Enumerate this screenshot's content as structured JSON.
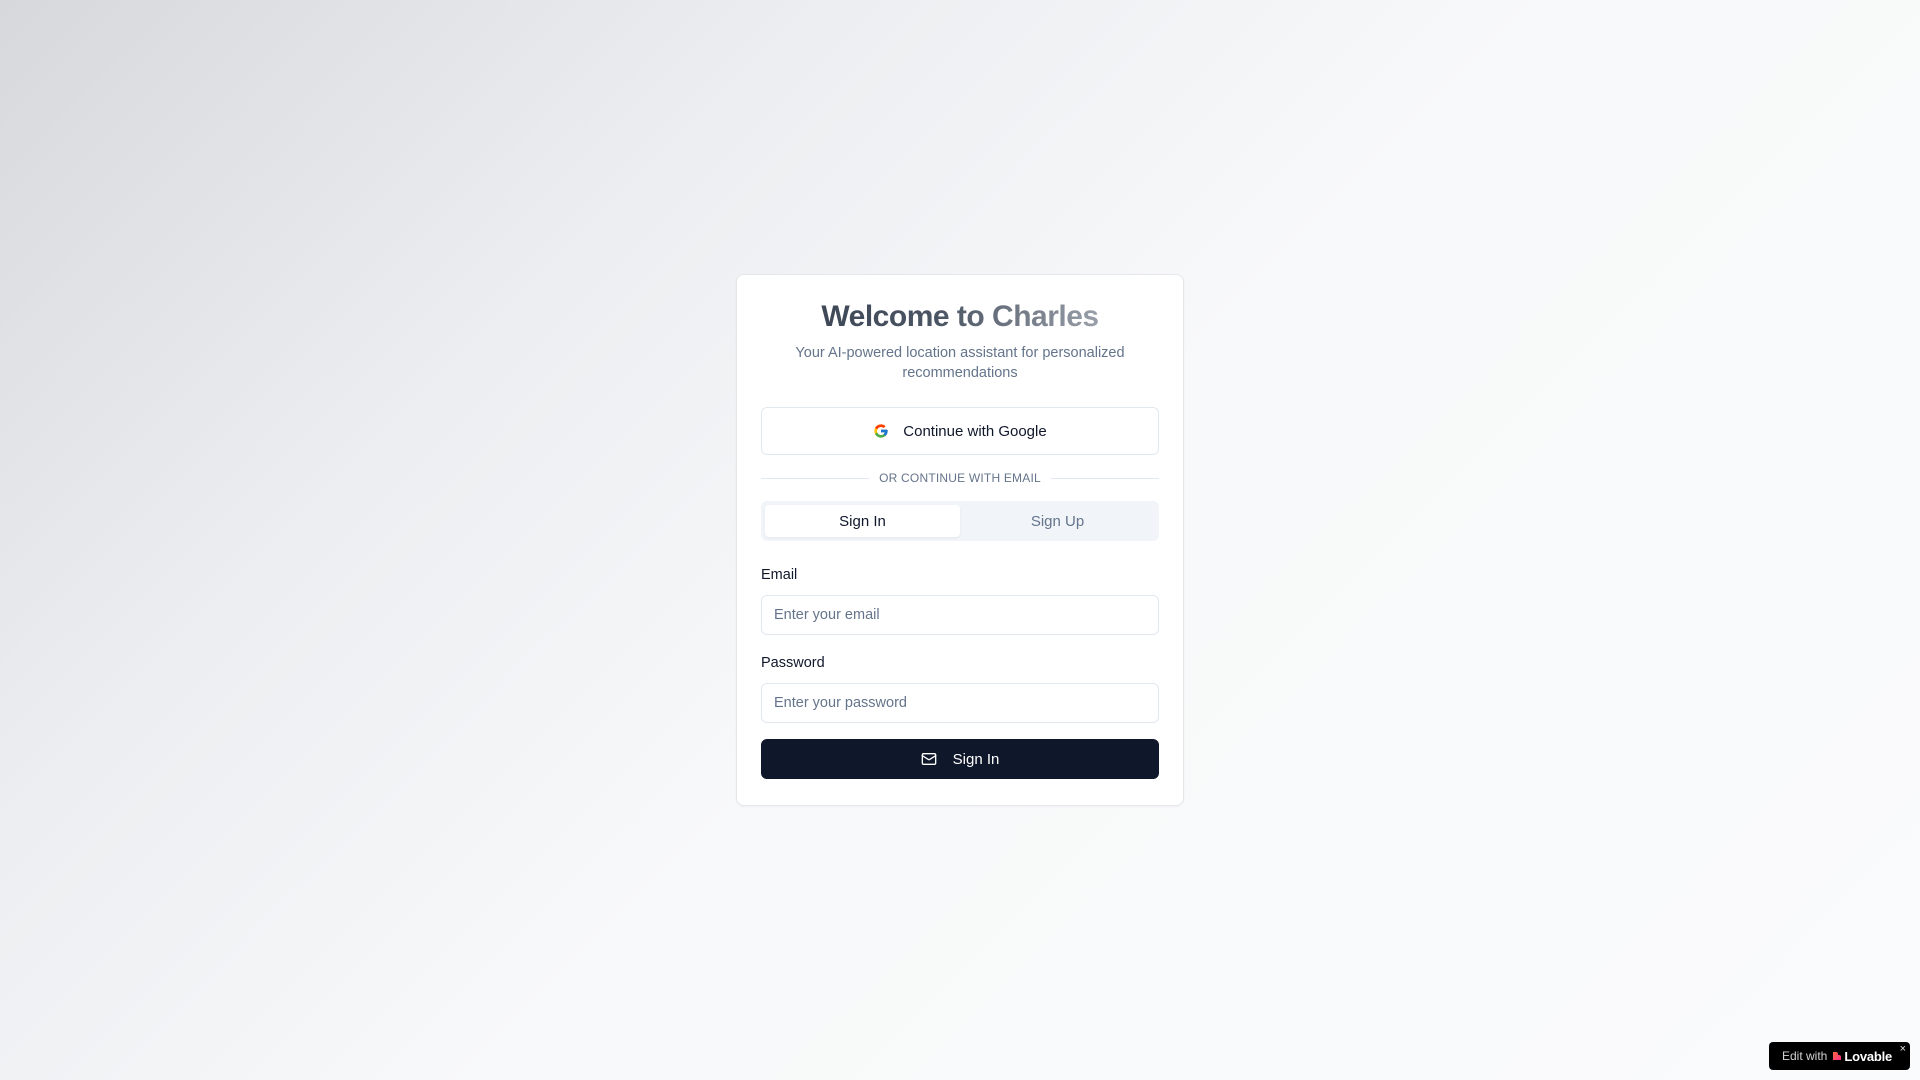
{
  "auth_card": {
    "title": "Welcome to Charles",
    "subtitle": "Your AI-powered location assistant for personalized recommendations",
    "google_button_label": "Continue with Google",
    "divider_text": "OR CONTINUE WITH EMAIL",
    "tabs": [
      {
        "label": "Sign In",
        "active": true
      },
      {
        "label": "Sign Up",
        "active": false
      }
    ],
    "email": {
      "label": "Email",
      "placeholder": "Enter your email",
      "value": ""
    },
    "password": {
      "label": "Password",
      "placeholder": "Enter your password",
      "value": ""
    },
    "submit_label": "Sign In",
    "submit_icon": "mail-icon",
    "google_icon": "google-icon"
  },
  "lovable_badge": {
    "edit_text": "Edit with",
    "brand_text": "Lovable",
    "close_glyph": "×"
  },
  "colors": {
    "primary_button": "#0f172a",
    "muted_text": "#64748b",
    "border": "#e2e8f0",
    "tab_background": "#f1f5f9"
  }
}
